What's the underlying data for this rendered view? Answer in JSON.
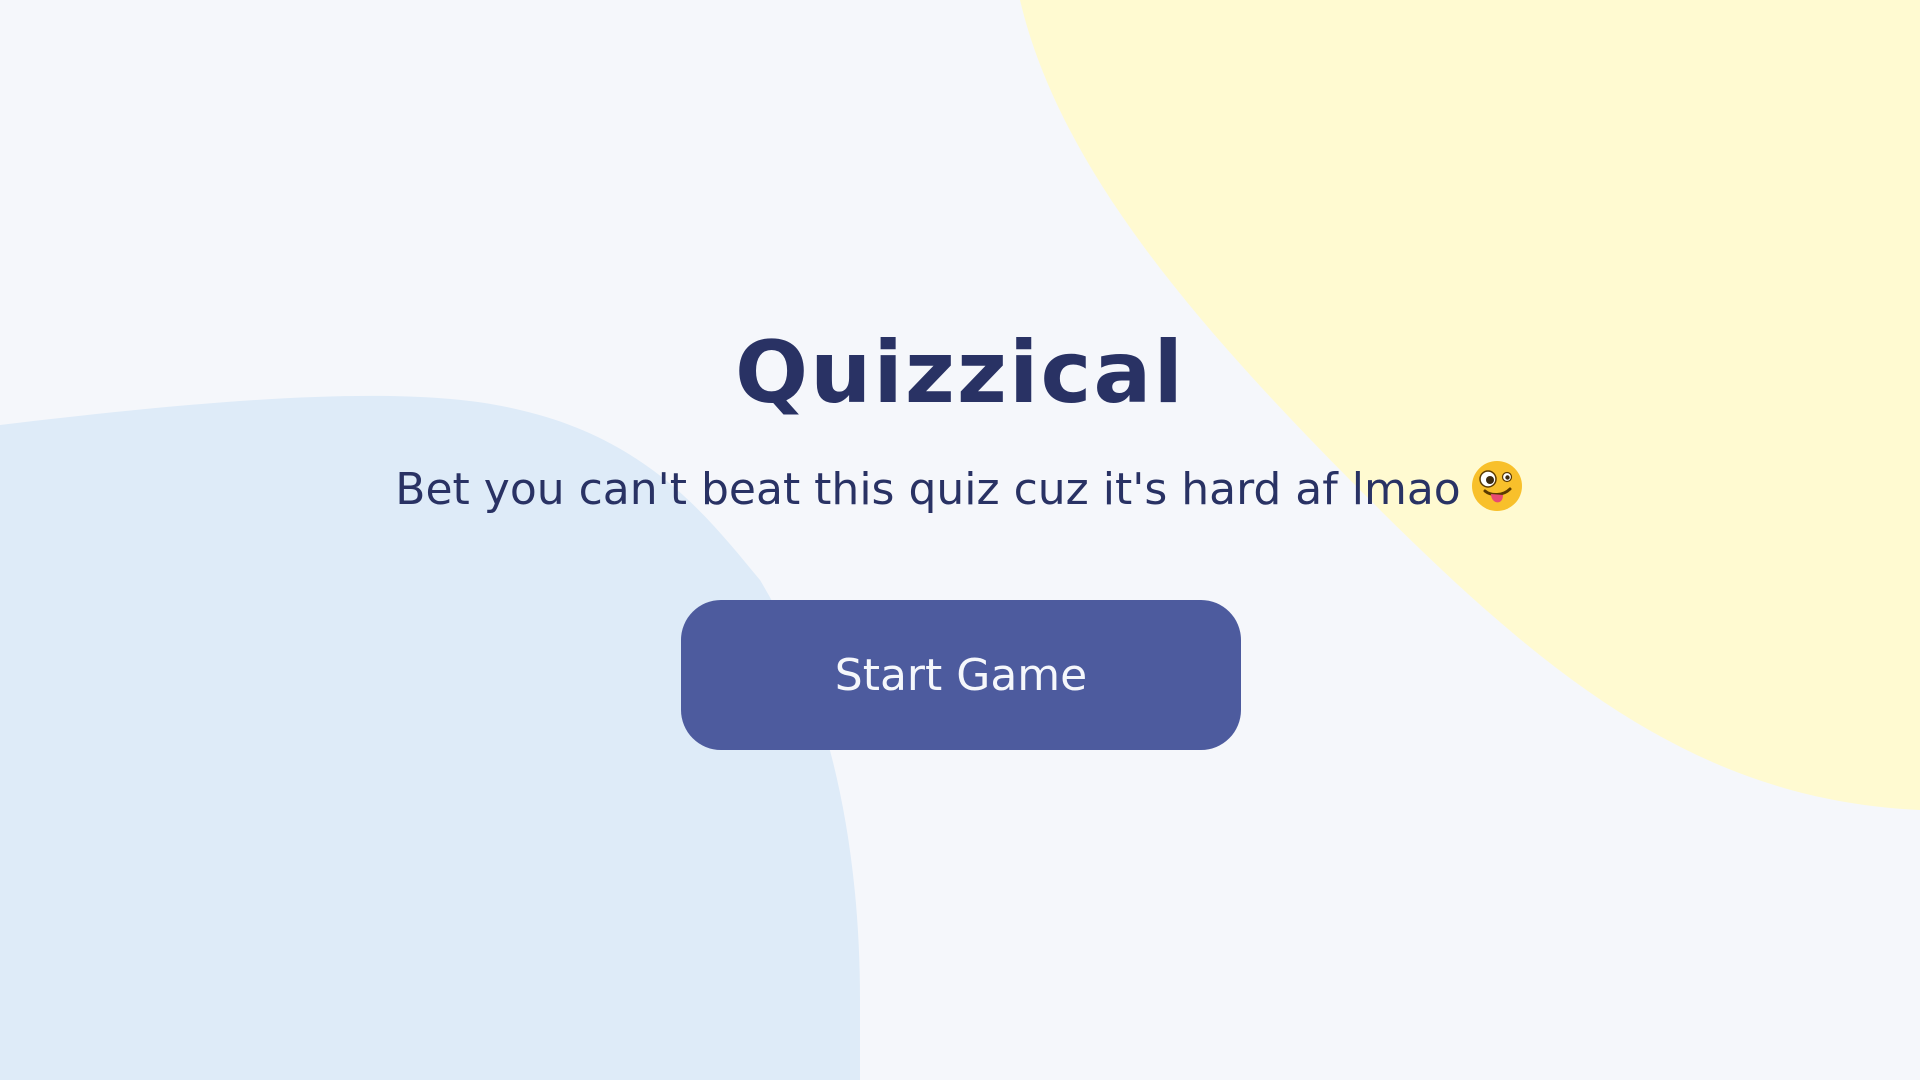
{
  "app": {
    "title": "Quizzical",
    "subtitle": "Bet you can't beat this quiz cuz it's hard af lmao"
  },
  "emoji": {
    "icon": "zany-face-icon",
    "face_color": "#F8C02B",
    "tongue_color": "#E84A72"
  },
  "start_button": {
    "label": "Start Game"
  },
  "colors": {
    "background": "#F5F7FB",
    "blob_top_right": "#FFFAD1",
    "blob_bottom_left": "#DEEBF8",
    "text": "#293264",
    "button": "#4D5B9E",
    "button_text": "#F5F7FB"
  }
}
